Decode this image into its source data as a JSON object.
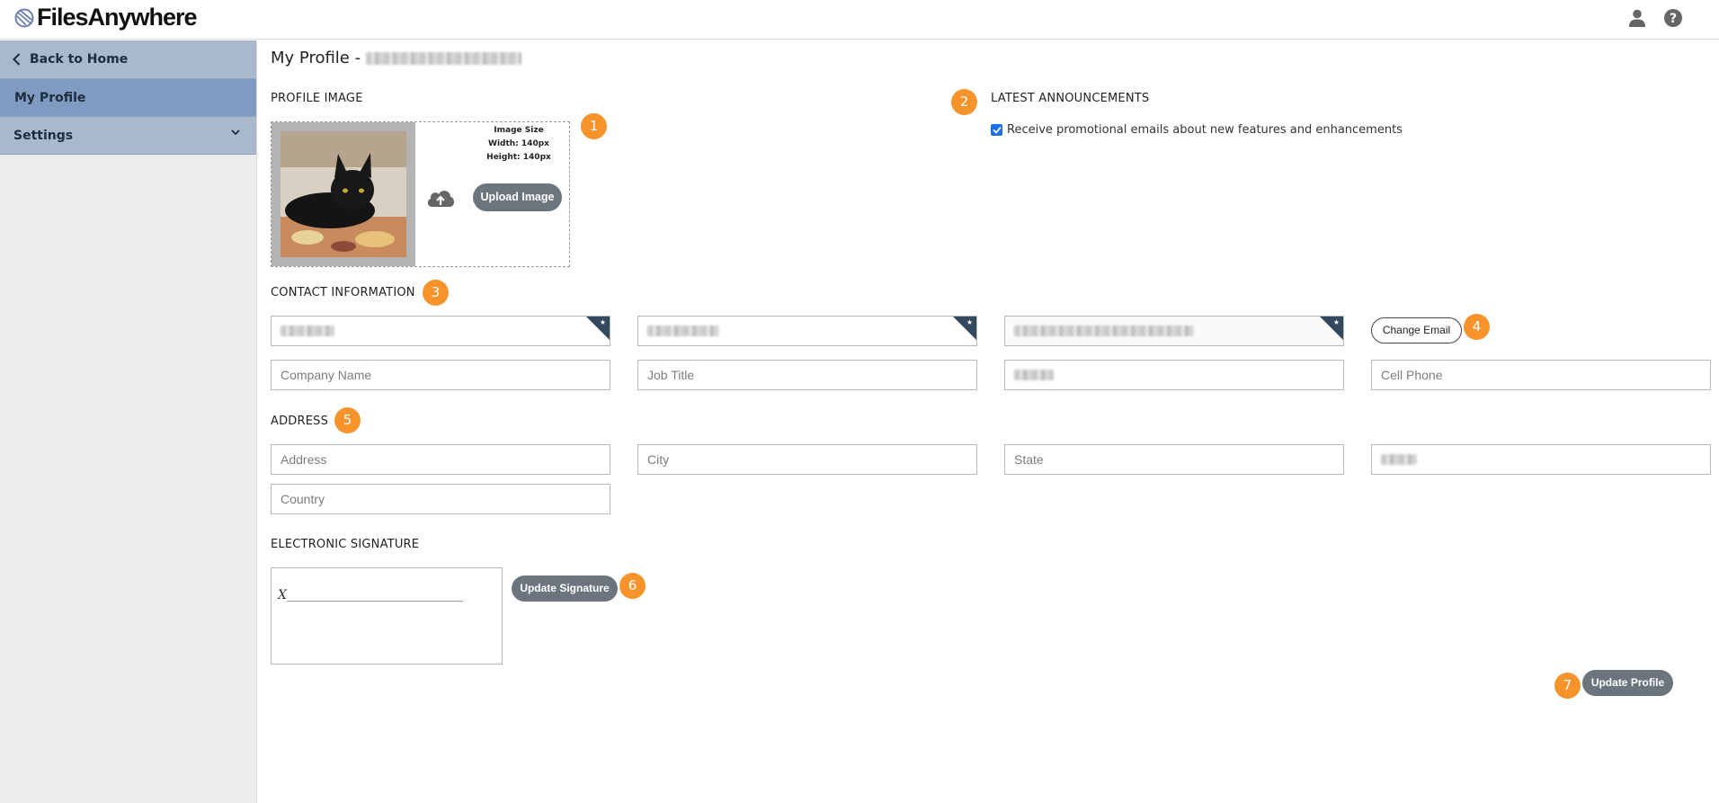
{
  "app": {
    "logo_text": "FilesAnywhere"
  },
  "header": {
    "icons": [
      "user-icon",
      "help-icon"
    ]
  },
  "sidebar": {
    "items": [
      {
        "label": "Back to Home",
        "icon": "chevron-left-icon"
      },
      {
        "label": "My Profile",
        "active": true
      },
      {
        "label": "Settings",
        "icon": "chevron-down-icon"
      }
    ]
  },
  "page": {
    "title": "My Profile -"
  },
  "profile_image": {
    "heading": "PROFILE IMAGE",
    "size_label": "Image Size",
    "width_label": "Width: 140px",
    "height_label": "Height: 140px",
    "upload_label": "Upload Image",
    "badge": "1"
  },
  "announcements": {
    "heading": "LATEST ANNOUNCEMENTS",
    "badge": "2",
    "checkbox_checked": true,
    "checkbox_label": "Receive promotional emails about new features and enhancements"
  },
  "contact": {
    "heading": "CONTACT INFORMATION",
    "badge": "3",
    "change_email_label": "Change Email",
    "change_email_badge": "4",
    "company_placeholder": "Company Name",
    "job_title_placeholder": "Job Title",
    "cell_phone_placeholder": "Cell Phone"
  },
  "address": {
    "heading": "ADDRESS",
    "badge": "5",
    "address_placeholder": "Address",
    "city_placeholder": "City",
    "state_placeholder": "State",
    "country_placeholder": "Country"
  },
  "signature": {
    "heading": "ELECTRONIC SIGNATURE",
    "line": "X____________________________",
    "update_label": "Update Signature",
    "badge": "6"
  },
  "footer": {
    "update_profile_label": "Update Profile",
    "badge": "7"
  },
  "colors": {
    "badge": "#f7932b",
    "sidebar_active": "#7f9bc2",
    "button": "#6c757d"
  }
}
